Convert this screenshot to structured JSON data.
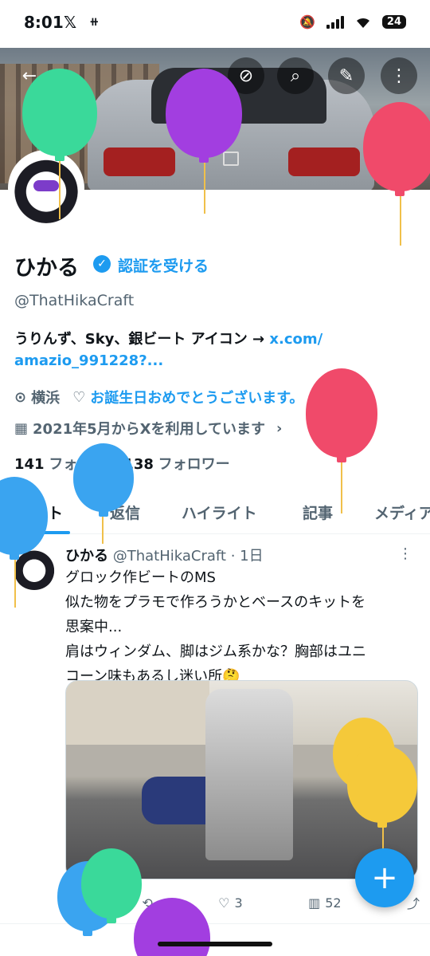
{
  "status_bar": {
    "time": "8:01",
    "x_logo": "𝕏",
    "extra_icon": "⧺",
    "battery": "24"
  },
  "header": {
    "back_icon": "←",
    "grok_icon": "⊘",
    "search_icon": "⌕",
    "edit_icon": "✎",
    "more_icon": "⋮"
  },
  "profile": {
    "name": "ひかる",
    "verified_icon": "✓",
    "get_verified": "認証を受ける",
    "handle": "@ThatHikaCraft",
    "bio_text": "うりんず、Sky、銀ビート アイコン → ",
    "bio_link_part1": "x.com/",
    "bio_link_part2": "amazio_991228?...",
    "location_icon": "⊙",
    "location": "横浜",
    "birthday_icon": "♡",
    "birthday": "お誕生日おめでとうございます。",
    "joined_icon": "▦",
    "joined": "2021年5月からXを利用しています",
    "joined_chevron": "›",
    "following_count": "141",
    "following_label": "フォロー",
    "followers_count": "138",
    "followers_label": "フォロワー"
  },
  "tabs": [
    "ポスト",
    "返信",
    "ハイライト",
    "記事",
    "メディア"
  ],
  "post": {
    "author": "ひかる",
    "handle_time": "@ThatHikaCraft · 1日",
    "more_icon": "⋮",
    "lines": [
      "グロック作ビートのMS",
      "似た物をプラモで作ろうかとベースのキットを",
      "思案中...",
      "肩はウィンダム、脚はジム系かな？胸部はユニ",
      "コーン味もあるし迷い所🤔"
    ],
    "actions": {
      "reply_icon": "○",
      "retweet_icon": "⟲",
      "like_icon": "♡",
      "like_count": "3",
      "views_icon": "▥",
      "views_count": "52",
      "share_icon": "⤴"
    }
  },
  "fab": {
    "icon": "+"
  },
  "colors": {
    "accent": "#1d9bf0",
    "text": "#0f1419",
    "secondary": "#536471"
  }
}
